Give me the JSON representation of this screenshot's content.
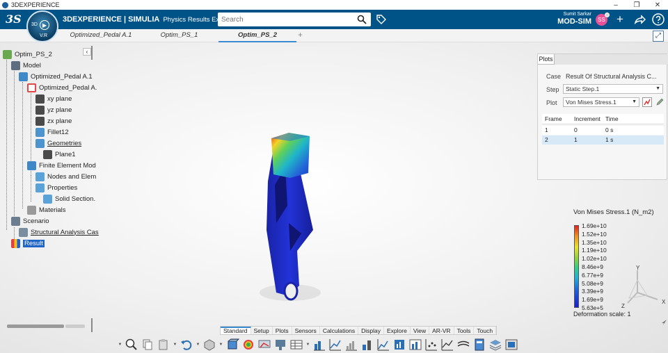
{
  "window": {
    "title": "3DEXPERIENCE"
  },
  "topbar": {
    "logo_text": "3S",
    "brand_main": "3DEXPERIENCE | SIMULIA",
    "brand_sub": "Physics Results Explorer",
    "search_placeholder": "Search",
    "user_name": "Sumit Sarkar",
    "collab_space": "MOD-SIM ⌄",
    "avatar_initials": "SS",
    "compass_3d": "3D",
    "compass_version": "V.R"
  },
  "tabs": [
    {
      "label": "Optimized_Pedal A.1"
    },
    {
      "label": "Optim_PS_1"
    },
    {
      "label": "Optim_PS_2"
    }
  ],
  "tab_add_label": "+",
  "tree": {
    "nodes": [
      {
        "label": "Optim_PS_2",
        "icon": "sim-root-icon"
      },
      {
        "label": "Model",
        "icon": "model-icon"
      },
      {
        "label": "Optimized_Pedal A.1",
        "icon": "product-icon"
      },
      {
        "label": "Optimized_Pedal A.",
        "icon": "part-icon"
      },
      {
        "label": "xy plane",
        "icon": "plane-icon"
      },
      {
        "label": "yz plane",
        "icon": "plane-icon"
      },
      {
        "label": "zx plane",
        "icon": "plane-icon"
      },
      {
        "label": "Fillet12",
        "icon": "fillet-icon"
      },
      {
        "label": "Geometries",
        "icon": "geometry-icon"
      },
      {
        "label": "Plane1",
        "icon": "plane-icon"
      },
      {
        "label": "Finite Element Mod",
        "icon": "fem-icon"
      },
      {
        "label": "Nodes and Elem",
        "icon": "mesh-icon"
      },
      {
        "label": "Properties",
        "icon": "properties-icon"
      },
      {
        "label": "Solid Section.",
        "icon": "section-icon"
      },
      {
        "label": "Materials",
        "icon": "materials-icon"
      },
      {
        "label": "Scenario",
        "icon": "scenario-icon"
      },
      {
        "label": "Structural Analysis Cas",
        "icon": "analysis-case-icon"
      },
      {
        "label": "Result",
        "icon": "result-icon"
      }
    ],
    "collapse_label": "‹"
  },
  "plots_panel": {
    "tab_label": "Plots",
    "case_label": "Case",
    "case_value": "Result Of Structural Analysis C...",
    "step_label": "Step",
    "step_value": "Static Step.1",
    "plot_label": "Plot",
    "plot_value": "Von Mises Stress.1",
    "columns": [
      "Frame",
      "Increment",
      "Time"
    ],
    "rows": [
      [
        "1",
        "0",
        "0 s"
      ],
      [
        "2",
        "1",
        "1 s"
      ]
    ],
    "selected_row": 1
  },
  "legend": {
    "title": "Von Mises Stress.1 (N_m2)",
    "values": [
      "1.69e+10",
      "1.52e+10",
      "1.35e+10",
      "1.19e+10",
      "1.02e+10",
      "8.46e+9",
      "6.77e+9",
      "5.08e+9",
      "3.39e+9",
      "1.69e+9",
      "5.63e+5"
    ],
    "deformation": "Deformation scale: 1"
  },
  "triad": {
    "x": "X",
    "y": "Y",
    "z": "Z"
  },
  "toolbar_tabs": [
    "Standard",
    "Setup",
    "Plots",
    "Sensors",
    "Calculations",
    "Display",
    "Explore",
    "View",
    "AR-VR",
    "Tools",
    "Touch"
  ],
  "active_toolbar_tab": "Standard",
  "window_buttons": [
    "–",
    "❐",
    "✕"
  ],
  "colors": {
    "topbar": "#005386",
    "accent": "#3a8ad0",
    "selection": "#1f64c8"
  }
}
